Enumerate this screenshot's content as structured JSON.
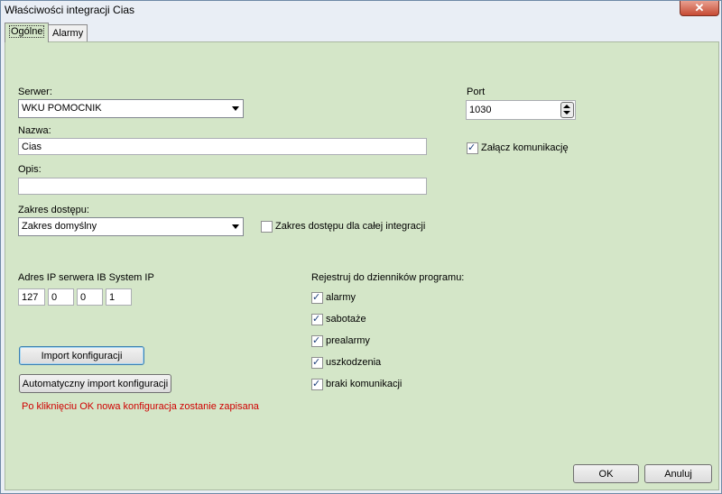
{
  "window": {
    "title": "Właściwości integracji Cias",
    "close_label": "✕"
  },
  "tabs": [
    {
      "label": "Ogólne"
    },
    {
      "label": "Alarmy"
    }
  ],
  "server": {
    "label": "Serwer:",
    "value": "WKU POMOCNIK"
  },
  "name": {
    "label": "Nazwa:",
    "value": "Cias"
  },
  "description": {
    "label": "Opis:",
    "value": ""
  },
  "access": {
    "label": "Zakres dostępu:",
    "value": "Zakres domyślny",
    "whole_label": "Zakres dostępu dla całej integracji",
    "whole_checked": false
  },
  "port": {
    "label": "Port",
    "value": "1030"
  },
  "enable": {
    "label": "Załącz komunikację",
    "checked": true
  },
  "ip": {
    "label": "Adres IP serwera IB System IP",
    "octets": [
      "127",
      "0",
      "0",
      "1"
    ]
  },
  "log": {
    "label": "Rejestruj do dzienników programu:",
    "items": [
      {
        "label": "alarmy",
        "checked": true
      },
      {
        "label": "sabotaże",
        "checked": true
      },
      {
        "label": "prealarmy",
        "checked": true
      },
      {
        "label": "uszkodzenia",
        "checked": true
      },
      {
        "label": "braki komunikacji",
        "checked": true
      }
    ]
  },
  "buttons": {
    "import": "Import konfiguracji",
    "auto_import": "Automatyczny import konfiguracji",
    "ok": "OK",
    "cancel": "Anuluj"
  },
  "note": "Po kliknięciu OK nowa konfiguracja zostanie zapisana"
}
